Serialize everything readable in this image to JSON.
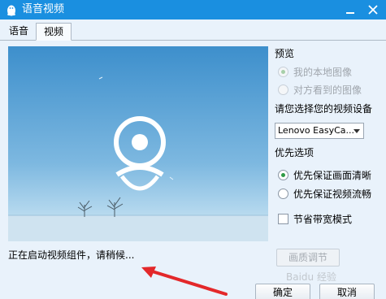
{
  "window": {
    "title": "语音视频",
    "app_icon": "penguin-icon",
    "minimize_icon": "minimize-icon",
    "close_icon": "close-icon"
  },
  "tabs": [
    {
      "label": "语音",
      "active": false
    },
    {
      "label": "视频",
      "active": true
    }
  ],
  "video": {
    "overlay_icon": "webcam-icon",
    "status_text": "正在启动视频组件，请稍候..."
  },
  "preview": {
    "label": "预览",
    "options": [
      {
        "label": "我的本地图像",
        "selected": true,
        "enabled": false
      },
      {
        "label": "对方看到的图像",
        "selected": false,
        "enabled": false
      }
    ]
  },
  "device": {
    "label": "请您选择您的视频设备",
    "selected": "Lenovo EasyCa..."
  },
  "priority": {
    "label": "优先选项",
    "options": [
      {
        "label": "优先保证画面清晰",
        "selected": true
      },
      {
        "label": "优先保证视频流畅",
        "selected": false
      }
    ]
  },
  "bandwidth": {
    "label": "节省带宽模式",
    "checked": false
  },
  "buttons": {
    "quality": "画质调节",
    "ok": "确定",
    "cancel": "取消"
  },
  "watermark": "Baidu 经验",
  "colors": {
    "titlebar": "#1a8fe0",
    "body_bg": "#e9f2fb",
    "annotation_arrow": "#e3282a",
    "selected_radio": "#2f9a46"
  }
}
